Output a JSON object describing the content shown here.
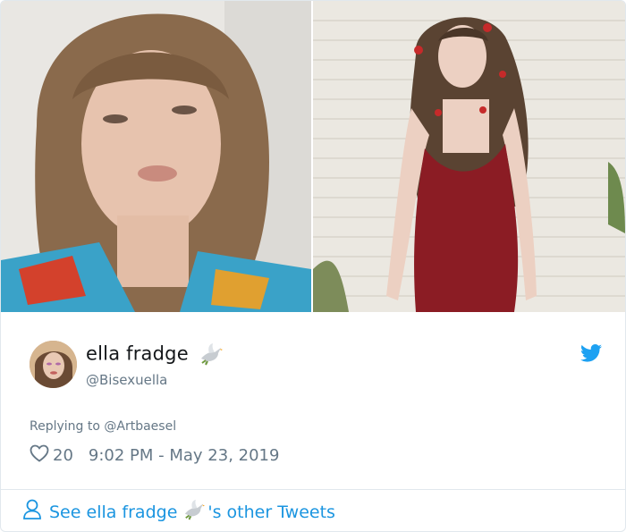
{
  "tweet": {
    "display_name": "ella fradge",
    "handle": "@Bisexuella",
    "replying_to_label": "Replying to",
    "replying_to_handle": "@Artbaesel",
    "likes": "20",
    "timestamp": "9:02 PM - May 23, 2019"
  },
  "footer": {
    "prefix": "See",
    "name": "ella fradge",
    "suffix": "'s other Tweets"
  },
  "icons": {
    "twitter": "twitter-bird-icon",
    "dove": "dove-emoji-icon",
    "heart": "heart-outline-icon",
    "person": "person-icon"
  },
  "colors": {
    "link_blue": "#1b95e0",
    "muted_gray": "#657786",
    "text_dark": "#14171a"
  }
}
